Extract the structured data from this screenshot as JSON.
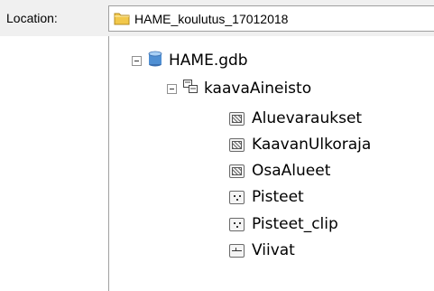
{
  "location": {
    "label": "Location:",
    "value": "HAME_koulutus_17012018"
  },
  "tree": {
    "geodatabase": {
      "label": "HAME.gdb",
      "icon": "geodatabase-cylinder-icon"
    },
    "dataset": {
      "label": "kaavaAineisto",
      "icon": "feature-dataset-icon"
    },
    "items": [
      {
        "label": "Aluevaraukset",
        "icon": "polygon-feature-class-icon"
      },
      {
        "label": "KaavanUlkoraja",
        "icon": "polygon-feature-class-icon"
      },
      {
        "label": "OsaAlueet",
        "icon": "polygon-feature-class-icon"
      },
      {
        "label": "Pisteet",
        "icon": "point-feature-class-icon"
      },
      {
        "label": "Pisteet_clip",
        "icon": "point-feature-class-icon"
      },
      {
        "label": "Viivat",
        "icon": "line-feature-class-icon"
      }
    ]
  },
  "colors": {
    "folder": "#f2c84b",
    "geodatabase_blue": "#4f8fd3",
    "border": "#a0a0a0"
  }
}
